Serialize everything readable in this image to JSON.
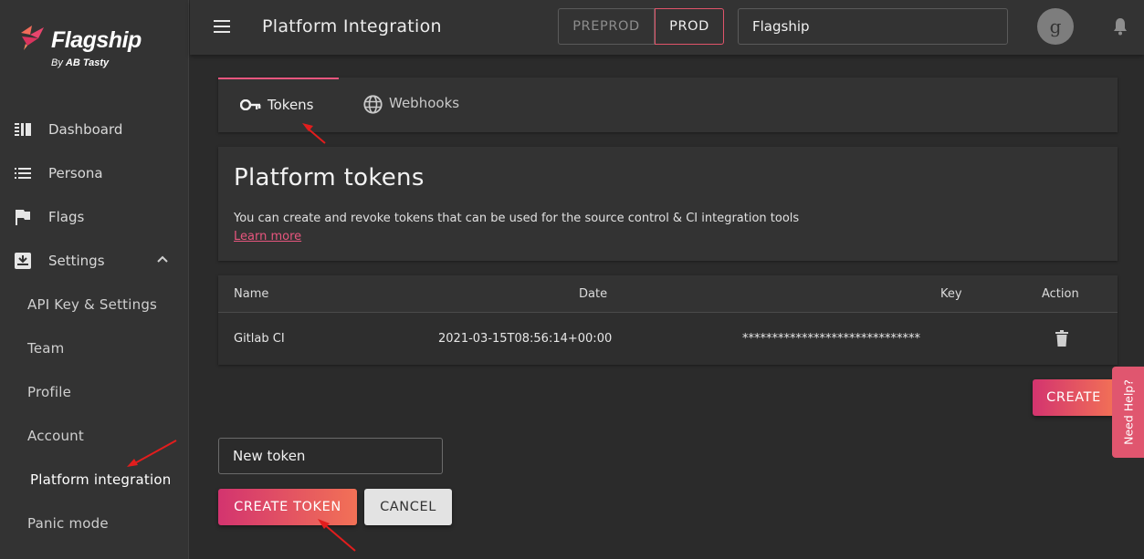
{
  "brand": {
    "name": "Flagship",
    "by_prefix": "By",
    "by_name": "AB Tasty"
  },
  "sidebar": {
    "items": [
      {
        "label": "Dashboard",
        "icon": "dashboard-icon"
      },
      {
        "label": "Persona",
        "icon": "list-icon"
      },
      {
        "label": "Flags",
        "icon": "flag-icon"
      },
      {
        "label": "Settings",
        "icon": "settings-inbox-icon",
        "expanded": true
      }
    ],
    "subitems": [
      {
        "label": "API Key & Settings"
      },
      {
        "label": "Team"
      },
      {
        "label": "Profile"
      },
      {
        "label": "Account"
      },
      {
        "label": "Platform integration",
        "active": true
      },
      {
        "label": "Panic mode"
      }
    ]
  },
  "header": {
    "title": "Platform Integration",
    "env_preprod": "PREPROD",
    "env_prod": "PROD",
    "env_selected": "PROD",
    "project": "Flagship",
    "avatar_letter": "g"
  },
  "tabs": [
    {
      "label": "Tokens",
      "icon": "key-icon",
      "active": true
    },
    {
      "label": "Webhooks",
      "icon": "globe-icon",
      "active": false
    }
  ],
  "info": {
    "title": "Platform tokens",
    "description": "You can create and revoke tokens that can be used for the source control & CI integration tools",
    "link": "Learn more"
  },
  "table": {
    "headers": {
      "name": "Name",
      "date": "Date",
      "key": "Key",
      "action": "Action"
    },
    "rows": [
      {
        "name": "Gitlab CI",
        "date": "2021-03-15T08:56:14+00:00",
        "key": "******************************",
        "action_icon": "trash-icon"
      }
    ]
  },
  "actions": {
    "create": "CREATE",
    "token_input_value": "New token",
    "create_token": "CREATE TOKEN",
    "cancel": "CANCEL"
  },
  "help": {
    "label": "Need Help?"
  },
  "colors": {
    "accent": "#e8567e",
    "gradient_start": "#d3346f",
    "gradient_end": "#f27156",
    "background": "#2b2b2b",
    "surface": "#333333"
  }
}
